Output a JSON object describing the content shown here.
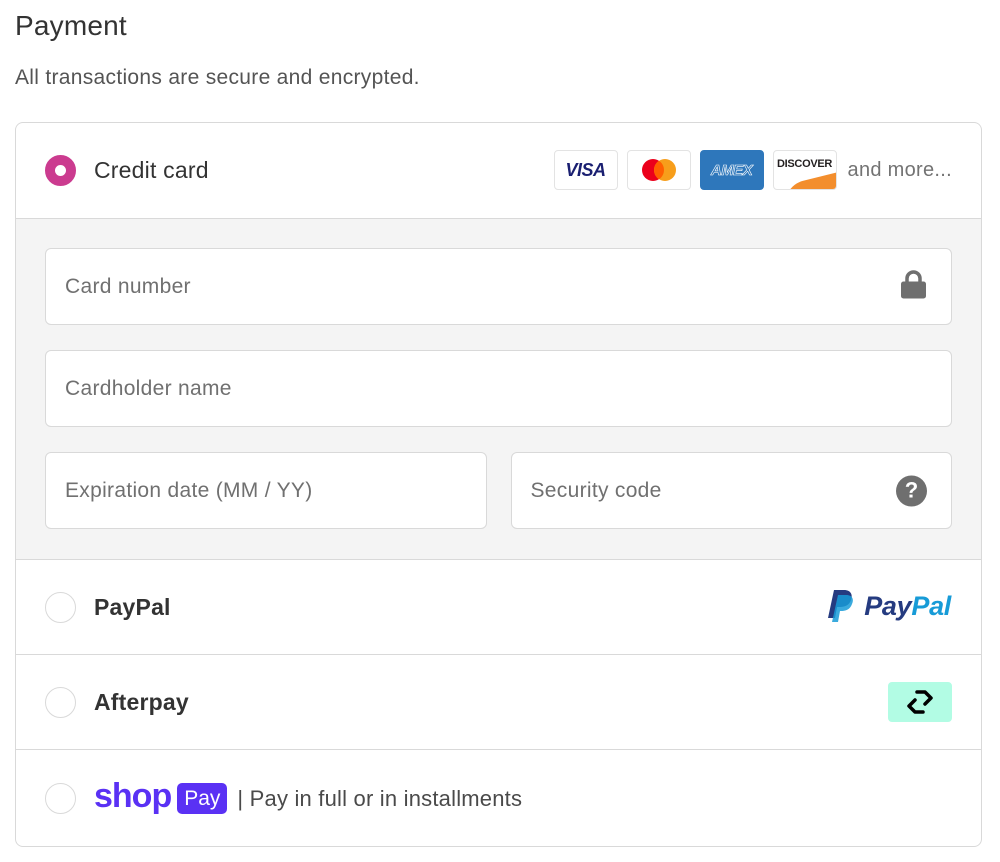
{
  "header": {
    "title": "Payment",
    "subtitle": "All transactions are secure and encrypted."
  },
  "payment_methods": {
    "credit_card": {
      "label": "Credit card",
      "selected": true,
      "card_brands": [
        "VISA",
        "Mastercard",
        "AMEX",
        "DISCOVER"
      ],
      "and_more": "and more...",
      "fields": {
        "card_number": {
          "placeholder": "Card number",
          "value": "",
          "icon": "lock-icon"
        },
        "cardholder_name": {
          "placeholder": "Cardholder name",
          "value": ""
        },
        "expiration": {
          "placeholder": "Expiration date (MM / YY)",
          "value": ""
        },
        "security_code": {
          "placeholder": "Security code",
          "value": "",
          "icon": "help-icon",
          "icon_glyph": "?"
        }
      }
    },
    "paypal": {
      "label": "PayPal",
      "selected": false,
      "logo_pay": "Pay",
      "logo_pal": "Pal"
    },
    "afterpay": {
      "label": "Afterpay",
      "selected": false
    },
    "shop_pay": {
      "selected": false,
      "brand_shop": "shop",
      "brand_pay": "Pay",
      "tagline": "| Pay in full or in installments"
    }
  },
  "colors": {
    "accent": "#cb3b8f",
    "shop_pay": "#5a31f4",
    "afterpay_bg": "#b2fce4",
    "paypal_dark": "#253b80",
    "paypal_light": "#179bd7",
    "amex": "#2e77bb"
  }
}
